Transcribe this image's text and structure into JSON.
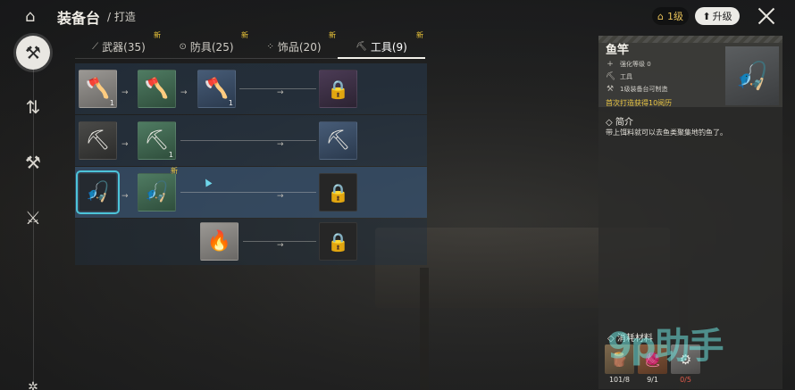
{
  "header": {
    "title": "装备台",
    "breadcrumb": "/ 打造",
    "level": "1级",
    "upgrade_label": "升级"
  },
  "tabs": [
    {
      "label": "武器(35)",
      "badge": "新",
      "icon": "sword-icon"
    },
    {
      "label": "防具(25)",
      "badge": "新",
      "icon": "armor-icon"
    },
    {
      "label": "饰品(20)",
      "badge": "新",
      "icon": "accessory-icon"
    },
    {
      "label": "工具(9)",
      "badge": "新",
      "icon": "tool-icon",
      "active": true
    }
  ],
  "rows": [
    {
      "slots": [
        {
          "count": "1"
        },
        {
          "count": ""
        },
        {
          "count": "1"
        },
        {
          "count": ""
        }
      ]
    },
    {
      "slots": [
        {
          "count": ""
        },
        {
          "count": "1"
        },
        {
          "count": ""
        }
      ]
    },
    {
      "slots": [
        {
          "count": ""
        },
        {
          "badge": "新"
        },
        {
          "count": ""
        }
      ]
    },
    {
      "slots": [
        {
          "count": ""
        },
        {
          "count": ""
        }
      ]
    }
  ],
  "detail": {
    "name": "鱼竿",
    "stats": [
      "强化等级 0",
      "工具",
      "1级装备台可制造"
    ],
    "first_craft": "首次打造获得10阅历",
    "intro_title": "◇ 简介",
    "intro_text": "带上饵料就可以去鱼类聚集地钓鱼了。",
    "materials_title": "◇ 消耗材料",
    "materials": [
      {
        "count": "101/8",
        "color": "normal"
      },
      {
        "count": "9/1",
        "color": "normal"
      },
      {
        "count": "0/5",
        "color": "red"
      }
    ]
  },
  "watermark": "9p助手",
  "colors": {
    "accent": "#4dc4d8",
    "new_badge": "#f0c93a",
    "insufficient": "#e25a4a"
  }
}
